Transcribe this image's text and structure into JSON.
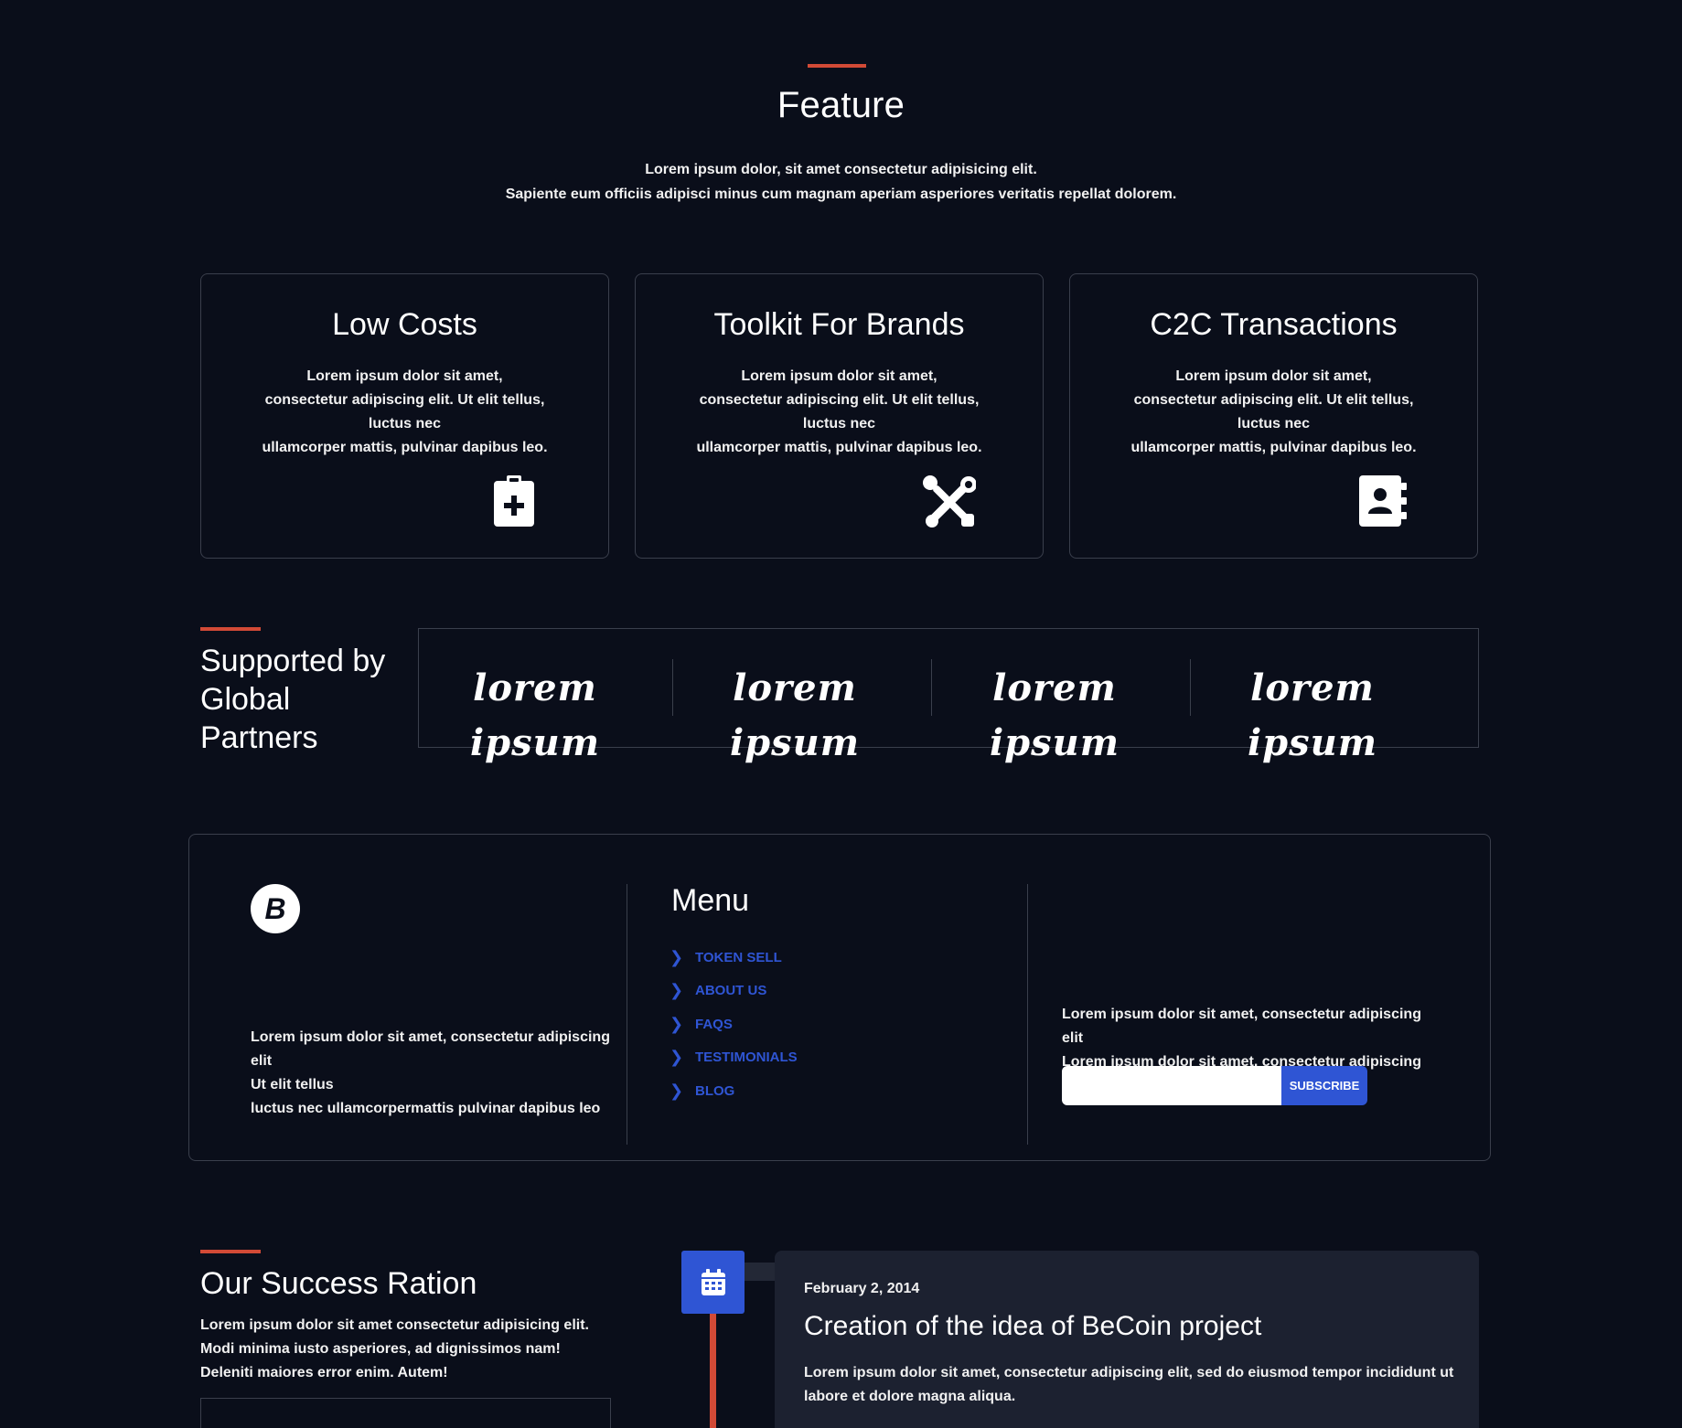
{
  "feature": {
    "title": "Feature",
    "subtitle_line1": "Lorem ipsum dolor, sit amet consectetur adipisicing elit.",
    "subtitle_line2": "Sapiente eum officiis adipisci minus cum magnam aperiam asperiores veritatis repellat dolorem."
  },
  "cards": [
    {
      "title": "Low Costs",
      "line1": "Lorem ipsum dolor sit amet,",
      "line2": "consectetur adipiscing elit. Ut elit tellus,",
      "line3": "luctus nec",
      "line4": "ullamcorper mattis, pulvinar dapibus leo.",
      "icon": "clipboard-plus-icon"
    },
    {
      "title": "Toolkit For Brands",
      "line1": "Lorem ipsum dolor sit amet,",
      "line2": "consectetur adipiscing elit. Ut elit tellus,",
      "line3": "luctus nec",
      "line4": "ullamcorper mattis, pulvinar dapibus leo.",
      "icon": "tools-icon"
    },
    {
      "title": "C2C Transactions",
      "line1": "Lorem ipsum dolor sit amet,",
      "line2": "consectetur adipiscing elit. Ut elit tellus,",
      "line3": "luctus nec",
      "line4": "ullamcorper mattis, pulvinar dapibus leo.",
      "icon": "address-book-icon"
    }
  ],
  "partners": {
    "title": "Supported by Global Partners",
    "logos": [
      "Lorem ipsum",
      "Lorem ipsum",
      "Lorem ipsum",
      "Lorem ipsum"
    ]
  },
  "footer": {
    "logo_icon": "bitcoin-icon",
    "logo_glyph": "B",
    "about_line1": "Lorem ipsum dolor sit amet, consectetur adipiscing elit",
    "about_line2": "Ut elit tellus",
    "about_line3": "luctus nec ullamcorpermattis pulvinar dapibus leo",
    "menu_title": "Menu",
    "menu_items": [
      "TOKEN SELL",
      "ABOUT US",
      "FAQS",
      "TESTIMONIALS",
      "BLOG"
    ],
    "newsletter_line1": "Lorem ipsum dolor sit amet, consectetur adipiscing elit",
    "newsletter_line2": "Lorem ipsum dolor sit amet, consectetur adipiscing elit.",
    "email_value": "",
    "subscribe_label": "SUBSCRIBE"
  },
  "success": {
    "title": "Our Success Ration",
    "description": "Lorem ipsum dolor sit amet consectetur adipisicing elit. Modi minima iusto asperiores, ad dignissimos nam! Deleniti maiores error enim. Autem!"
  },
  "timeline": {
    "icon": "calendar-icon",
    "date": "February 2, 2014",
    "title": "Creation of the idea of BeCoin project",
    "text": "Lorem ipsum dolor sit amet, consectetur adipiscing elit, sed do eiusmod tempor incididunt ut labore et dolore magna aliqua."
  },
  "colors": {
    "background": "#0a0e1a",
    "accent_red": "#d24a36",
    "accent_blue": "#2f55d4",
    "card_border": "#3a3f4c",
    "timeline_card": "#1c2130"
  }
}
